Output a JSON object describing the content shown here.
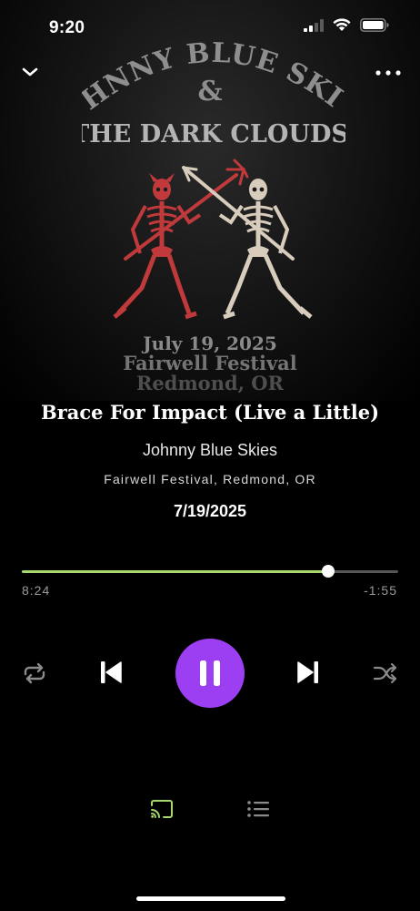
{
  "status_bar": {
    "time": "9:20",
    "icons": [
      "signal-icon",
      "wifi-icon",
      "battery-icon"
    ]
  },
  "nav": {
    "collapse_icon": "chevron-down-icon",
    "more_icon": "more-icon"
  },
  "album_art": {
    "band_line1": "JOHNNY BLUE SKIES",
    "band_amp": "&",
    "band_line2": "THE DARK CLOUDS",
    "poster_date": "July 19, 2025",
    "poster_event": "Fairwell Festival",
    "poster_location": "Redmond, OR"
  },
  "track": {
    "title": "Brace For Impact (Live a Little)",
    "artist": "Johnny Blue Skies",
    "venue": "Fairwell Festival, Redmond, OR",
    "date": "7/19/2025"
  },
  "progress": {
    "elapsed": "8:24",
    "remaining": "-1:55",
    "fraction": 0.815
  },
  "controls": {
    "repeat_icon": "repeat-icon",
    "previous_icon": "skip-previous-icon",
    "play_pause_icon": "pause-icon",
    "next_icon": "skip-next-icon",
    "shuffle_icon": "shuffle-icon"
  },
  "bottom": {
    "cast_icon": "cast-icon",
    "queue_icon": "queue-list-icon"
  },
  "colors": {
    "accent_green": "#a6d86b",
    "play_purple": "#9c3ff2",
    "devil_red": "#c0393b",
    "skeleton_bone": "#d8cdbd",
    "poster_text": "#8a8a8a"
  }
}
